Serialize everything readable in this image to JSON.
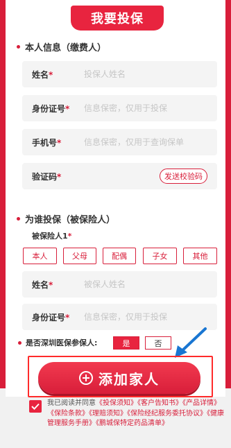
{
  "title": "我要投保",
  "applicant_section": {
    "heading": "本人信息（缴费人）",
    "fields": {
      "name": {
        "label": "姓名",
        "placeholder": "投保人姓名"
      },
      "id": {
        "label": "身份证号",
        "placeholder": "信息保密，仅用于投保"
      },
      "phone": {
        "label": "手机号",
        "placeholder": "信息保密，仅用于查询保单"
      },
      "code": {
        "label": "验证码",
        "placeholder": "",
        "send_button": "发送校验码"
      }
    }
  },
  "insured_section": {
    "heading": "为谁投保（被保险人）",
    "insured_label": "被保险人1",
    "relations": [
      "本人",
      "父母",
      "配偶",
      "子女",
      "其他"
    ],
    "fields": {
      "name": {
        "label": "姓名",
        "placeholder": "被保人姓名"
      },
      "id": {
        "label": "身份证号",
        "placeholder": "信息保密，仅用于投保"
      }
    }
  },
  "shenzhen": {
    "question": "是否深圳医保参保人:",
    "yes": "是",
    "no": "否"
  },
  "required_mark": "*",
  "add_button": "添加家人",
  "agreement": {
    "prefix": "我已阅读并同意",
    "docs": "《投保须知》《客户告知书》《产品详情》《保险条款》《理赔须知》《保险经纪服务委托协议》《健康管理服务手册》《鹏城保特定药品清单》"
  },
  "colors": {
    "accent": "#d81e3a",
    "button": "#e8243f"
  }
}
